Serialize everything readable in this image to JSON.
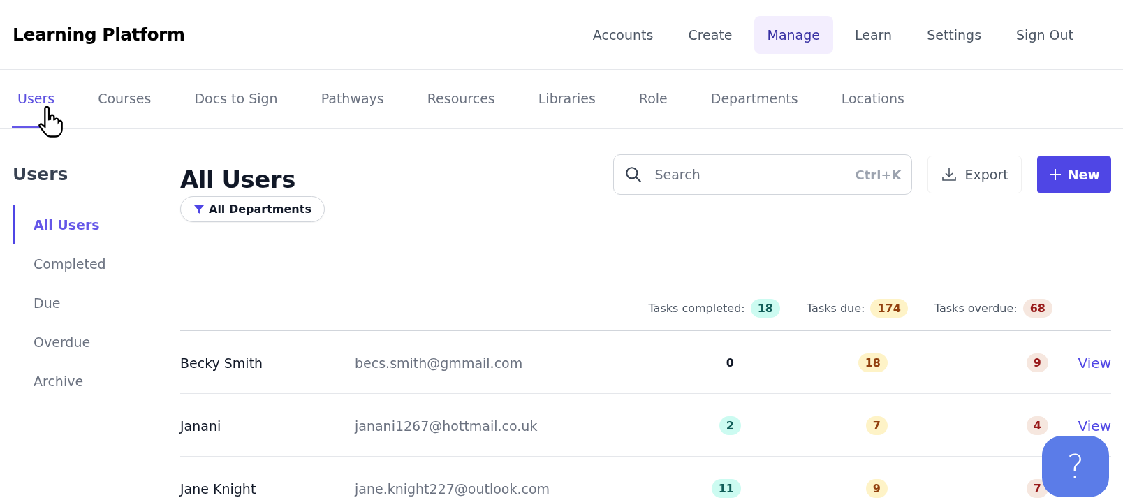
{
  "brand": "Learning Platform",
  "top_nav": [
    {
      "label": "Accounts",
      "selected": false
    },
    {
      "label": "Create",
      "selected": false
    },
    {
      "label": "Manage",
      "selected": true
    },
    {
      "label": "Learn",
      "selected": false
    },
    {
      "label": "Settings",
      "selected": false
    },
    {
      "label": "Sign Out",
      "selected": false
    }
  ],
  "tabs": [
    {
      "label": "Users",
      "selected": true
    },
    {
      "label": "Courses",
      "selected": false
    },
    {
      "label": "Docs to Sign",
      "selected": false
    },
    {
      "label": "Pathways",
      "selected": false
    },
    {
      "label": "Resources",
      "selected": false
    },
    {
      "label": "Libraries",
      "selected": false
    },
    {
      "label": "Role",
      "selected": false
    },
    {
      "label": "Departments",
      "selected": false
    },
    {
      "label": "Locations",
      "selected": false
    }
  ],
  "sidebar": {
    "title": "Users",
    "items": [
      {
        "label": "All Users",
        "selected": true
      },
      {
        "label": "Completed",
        "selected": false
      },
      {
        "label": "Due",
        "selected": false
      },
      {
        "label": "Overdue",
        "selected": false
      },
      {
        "label": "Archive",
        "selected": false
      }
    ]
  },
  "page_title": "All Users",
  "filter": "All Departments",
  "search": {
    "placeholder": "Search",
    "shortcut": "Ctrl+K"
  },
  "export_button": "Export",
  "new_button": "New",
  "stats": [
    {
      "label": "Tasks completed:",
      "value": "18",
      "kind": "completed"
    },
    {
      "label": "Tasks due:",
      "value": "174",
      "kind": "due"
    },
    {
      "label": "Tasks overdue:",
      "value": "68",
      "kind": "overdue"
    }
  ],
  "rows": [
    {
      "name": "Becky Smith",
      "email": "becs.smith@gmmail.com",
      "completed": "0",
      "completed_badge": false,
      "due": "18",
      "overdue": "9",
      "action": "View"
    },
    {
      "name": "Janani",
      "email": "janani1267@hottmail.co.uk",
      "completed": "2",
      "completed_badge": true,
      "due": "7",
      "overdue": "4",
      "action": "View"
    },
    {
      "name": "Jane Knight",
      "email": "jane.knight227@outlook.com",
      "completed": "11",
      "completed_badge": true,
      "due": "9",
      "overdue": "7"
    }
  ],
  "help_button": "?"
}
